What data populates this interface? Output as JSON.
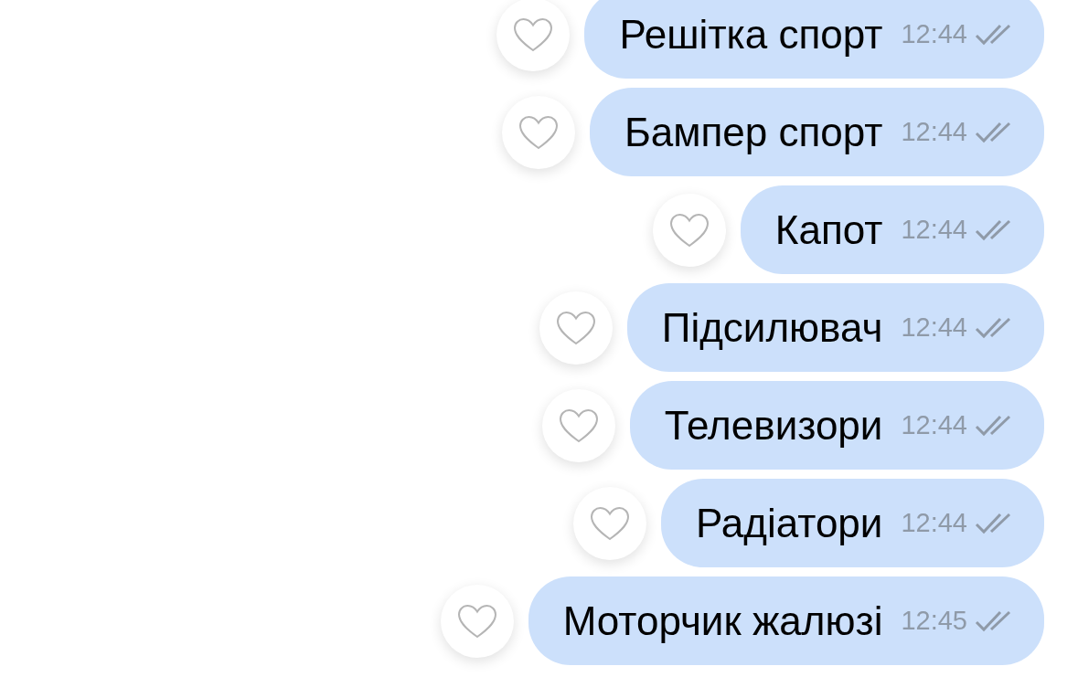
{
  "messages": [
    {
      "text": "Решітка спорт",
      "time": "12:44",
      "read": true,
      "liked": false
    },
    {
      "text": "Бампер спорт",
      "time": "12:44",
      "read": true,
      "liked": false
    },
    {
      "text": "Капот",
      "time": "12:44",
      "read": true,
      "liked": false
    },
    {
      "text": "Підсилювач",
      "time": "12:44",
      "read": true,
      "liked": false
    },
    {
      "text": "Телевизори",
      "time": "12:44",
      "read": true,
      "liked": false
    },
    {
      "text": "Радіатори",
      "time": "12:44",
      "read": true,
      "liked": false
    },
    {
      "text": "Моторчик жалюзі",
      "time": "12:45",
      "read": true,
      "liked": false
    }
  ]
}
